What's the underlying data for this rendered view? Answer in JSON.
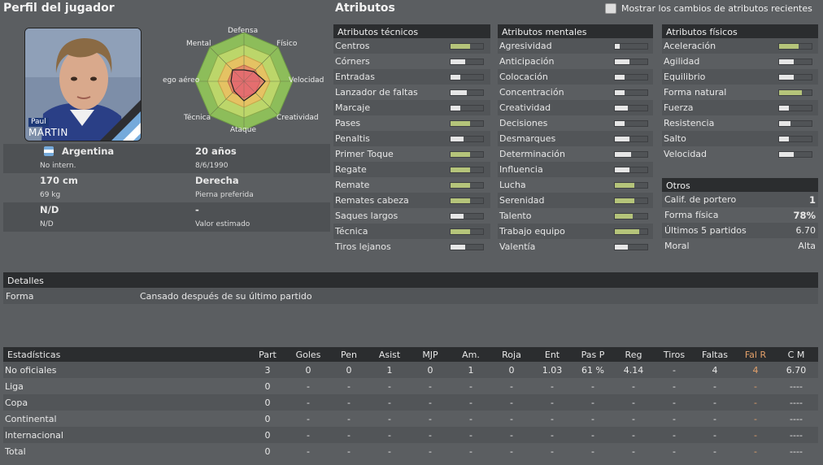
{
  "profile": {
    "title": "Perfil del jugador",
    "first_name": "Paul",
    "last_name": "MARTIN",
    "radar_labels": [
      "Defensa",
      "Físico",
      "Velocidad",
      "Creatividad",
      "Ataque",
      "Técnica",
      "Juego aéreo",
      "Mental"
    ],
    "radar_labels_visible": {
      "juego_aereo": "ego aéreo"
    },
    "nationality": "Argentina",
    "intl": "No intern.",
    "age": "20 años",
    "dob": "8/6/1990",
    "height": "170 cm",
    "weight": "69 kg",
    "foot": "Derecha",
    "foot_label": "Pierna preferida",
    "value_top_left": "N/D",
    "value_sub_left": "N/D",
    "value_top_right": "-",
    "value_label": "Valor estimado"
  },
  "attributes": {
    "title": "Atributos",
    "show_changes_label": "Mostrar los cambios de atributos recientes",
    "technical": {
      "title": "Atributos técnicos",
      "items": [
        {
          "label": "Centros",
          "level": 0.6,
          "green": true
        },
        {
          "label": "Córners",
          "level": 0.45,
          "green": false
        },
        {
          "label": "Entradas",
          "level": 0.3,
          "green": false
        },
        {
          "label": "Lanzador de faltas",
          "level": 0.5,
          "green": false
        },
        {
          "label": "Marcaje",
          "level": 0.3,
          "green": false
        },
        {
          "label": "Pases",
          "level": 0.6,
          "green": true
        },
        {
          "label": "Penaltis",
          "level": 0.4,
          "green": false
        },
        {
          "label": "Primer Toque",
          "level": 0.6,
          "green": true
        },
        {
          "label": "Regate",
          "level": 0.6,
          "green": true
        },
        {
          "label": "Remate",
          "level": 0.6,
          "green": true
        },
        {
          "label": "Remates cabeza",
          "level": 0.6,
          "green": true
        },
        {
          "label": "Saques largos",
          "level": 0.4,
          "green": false
        },
        {
          "label": "Técnica",
          "level": 0.6,
          "green": true
        },
        {
          "label": "Tiros lejanos",
          "level": 0.45,
          "green": false
        }
      ]
    },
    "mental": {
      "title": "Atributos mentales",
      "items": [
        {
          "label": "Agresividad",
          "level": 0.15,
          "green": false
        },
        {
          "label": "Anticipación",
          "level": 0.45,
          "green": false
        },
        {
          "label": "Colocación",
          "level": 0.3,
          "green": false
        },
        {
          "label": "Concentración",
          "level": 0.3,
          "green": false
        },
        {
          "label": "Creatividad",
          "level": 0.4,
          "green": false
        },
        {
          "label": "Decisiones",
          "level": 0.3,
          "green": false
        },
        {
          "label": "Desmarques",
          "level": 0.45,
          "green": false
        },
        {
          "label": "Determinación",
          "level": 0.5,
          "green": false
        },
        {
          "label": "Influencia",
          "level": 0.45,
          "green": false
        },
        {
          "label": "Lucha",
          "level": 0.6,
          "green": true
        },
        {
          "label": "Serenidad",
          "level": 0.6,
          "green": true
        },
        {
          "label": "Talento",
          "level": 0.55,
          "green": true
        },
        {
          "label": "Trabajo equipo",
          "level": 0.75,
          "green": true
        },
        {
          "label": "Valentía",
          "level": 0.4,
          "green": false
        }
      ]
    },
    "physical": {
      "title": "Atributos físicos",
      "items": [
        {
          "label": "Aceleración",
          "level": 0.6,
          "green": true
        },
        {
          "label": "Agilidad",
          "level": 0.45,
          "green": false
        },
        {
          "label": "Equilibrio",
          "level": 0.45,
          "green": false
        },
        {
          "label": "Forma natural",
          "level": 0.7,
          "green": true
        },
        {
          "label": "Fuerza",
          "level": 0.3,
          "green": false
        },
        {
          "label": "Resistencia",
          "level": 0.35,
          "green": false
        },
        {
          "label": "Salto",
          "level": 0.3,
          "green": false
        },
        {
          "label": "Velocidad",
          "level": 0.45,
          "green": false
        }
      ]
    },
    "others": {
      "title": "Otros",
      "items": [
        {
          "label": "Calif. de portero",
          "value": "1"
        },
        {
          "label": "Forma física",
          "value": "78%"
        },
        {
          "label": "Últimos 5 partidos",
          "value": "6.70"
        },
        {
          "label": "Moral",
          "value": "Alta"
        }
      ]
    }
  },
  "details": {
    "title": "Detalles",
    "row_label": "Forma",
    "row_value": "Cansado después de su último partido"
  },
  "stats": {
    "title": "Estadísticas",
    "columns": [
      "Part",
      "Goles",
      "Pen",
      "Asist",
      "MJP",
      "Am.",
      "Roja",
      "Ent",
      "Pas P",
      "Reg",
      "Tiros",
      "Faltas",
      "Fal R",
      "C M"
    ],
    "rows": [
      {
        "label": "No oficiales",
        "values": [
          "3",
          "0",
          "0",
          "1",
          "0",
          "1",
          "0",
          "1.03",
          "61 %",
          "4.14",
          "-",
          "4",
          "4",
          "6.70"
        ]
      },
      {
        "label": "Liga",
        "values": [
          "0",
          "-",
          "-",
          "-",
          "-",
          "-",
          "-",
          "-",
          "-",
          "-",
          "-",
          "-",
          "-",
          "----"
        ]
      },
      {
        "label": "Copa",
        "values": [
          "0",
          "-",
          "-",
          "-",
          "-",
          "-",
          "-",
          "-",
          "-",
          "-",
          "-",
          "-",
          "-",
          "----"
        ]
      },
      {
        "label": "Continental",
        "values": [
          "0",
          "-",
          "-",
          "-",
          "-",
          "-",
          "-",
          "-",
          "-",
          "-",
          "-",
          "-",
          "-",
          "----"
        ]
      },
      {
        "label": "Internacional",
        "values": [
          "0",
          "-",
          "-",
          "-",
          "-",
          "-",
          "-",
          "-",
          "-",
          "-",
          "-",
          "-",
          "-",
          "----"
        ]
      },
      {
        "label": "Total",
        "values": [
          "0",
          "-",
          "-",
          "-",
          "-",
          "-",
          "-",
          "-",
          "-",
          "-",
          "-",
          "-",
          "-",
          "----"
        ]
      }
    ]
  }
}
